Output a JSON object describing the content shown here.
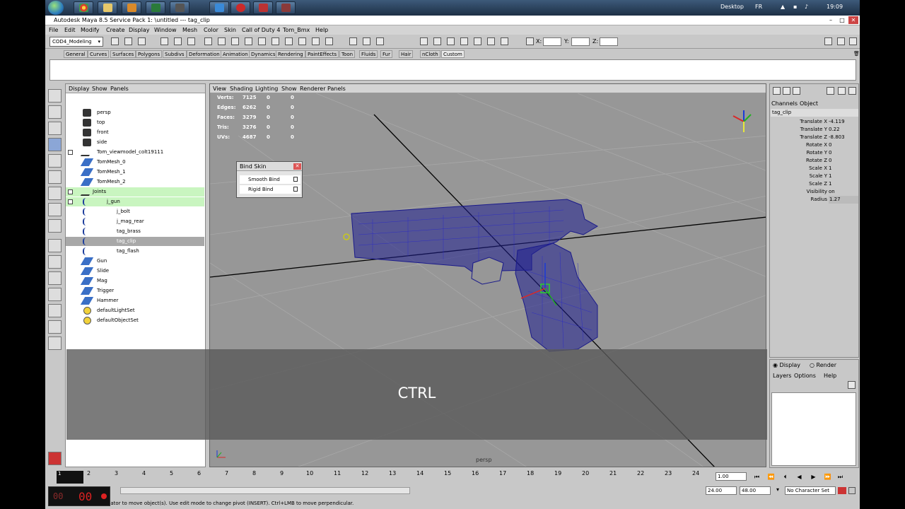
{
  "taskbar": {
    "tray_desktop": "Desktop",
    "tray_lang": "FR",
    "clock": "19:09"
  },
  "window": {
    "title": "Autodesk Maya 8.5 Service Pack 1: \\untitled   ---   tag_clip"
  },
  "menu": [
    "File",
    "Edit",
    "Modify",
    "Create",
    "Display",
    "Window",
    "Mesh",
    "Color",
    "Skin",
    "Call of Duty 4",
    "Tom_Bmx",
    "Help"
  ],
  "status_line": {
    "mode": "COD4_Modeling",
    "x_label": "X:",
    "y_label": "Y:",
    "z_label": "Z:"
  },
  "shelf_tabs": [
    "General",
    "Curves",
    "Surfaces",
    "Polygons",
    "Subdivs",
    "Deformation",
    "Animation",
    "Dynamics",
    "Rendering",
    "PaintEffects",
    "Toon",
    "Fluids",
    "Fur",
    "Hair",
    "nCloth",
    "Custom"
  ],
  "outliner": {
    "menu": [
      "Display",
      "Show",
      "Panels"
    ],
    "rows": [
      {
        "label": "persp"
      },
      {
        "label": "top"
      },
      {
        "label": "front"
      },
      {
        "label": "side"
      },
      {
        "label": "Tom_viewmodel_colt19111"
      },
      {
        "label": "TomMesh_0"
      },
      {
        "label": "TomMesh_1"
      },
      {
        "label": "TomMesh_2"
      },
      {
        "label": "Joints"
      },
      {
        "label": "j_gun"
      },
      {
        "label": "j_bolt"
      },
      {
        "label": "j_mag_rear"
      },
      {
        "label": "tag_brass"
      },
      {
        "label": "tag_clip"
      },
      {
        "label": "tag_flash"
      },
      {
        "label": "Gun"
      },
      {
        "label": "Slide"
      },
      {
        "label": "Mag"
      },
      {
        "label": "Trigger"
      },
      {
        "label": "Hammer"
      },
      {
        "label": "defaultLightSet"
      },
      {
        "label": "defaultObjectSet"
      }
    ]
  },
  "viewport": {
    "menu": [
      "View",
      "Shading",
      "Lighting",
      "Show",
      "Renderer",
      "Panels"
    ],
    "hud": [
      {
        "label": "Verts:",
        "values": [
          "7125",
          "0",
          "0"
        ]
      },
      {
        "label": "Edges:",
        "values": [
          "6262",
          "0",
          "0"
        ]
      },
      {
        "label": "Faces:",
        "values": [
          "3279",
          "0",
          "0"
        ]
      },
      {
        "label": "Tris:",
        "values": [
          "3276",
          "0",
          "0"
        ]
      },
      {
        "label": "UVs:",
        "values": [
          "4687",
          "0",
          "0"
        ]
      }
    ],
    "camera": "persp"
  },
  "bind_skin": {
    "title": "Bind Skin",
    "smooth": "Smooth Bind",
    "rigid": "Rigid Bind"
  },
  "channel_box": {
    "tabs": [
      "Channels",
      "Object"
    ],
    "node": "tag_clip",
    "channels": [
      {
        "name": "Translate X",
        "value": "-4.119"
      },
      {
        "name": "Translate Y",
        "value": "0.22"
      },
      {
        "name": "Translate Z",
        "value": "-8.803"
      },
      {
        "name": "Rotate X",
        "value": "0"
      },
      {
        "name": "Rotate Y",
        "value": "0"
      },
      {
        "name": "Rotate Z",
        "value": "0"
      },
      {
        "name": "Scale X",
        "value": "1"
      },
      {
        "name": "Scale Y",
        "value": "1"
      },
      {
        "name": "Scale Z",
        "value": "1"
      },
      {
        "name": "Visibility",
        "value": "on"
      },
      {
        "name": "Radius",
        "value": "1.27"
      }
    ]
  },
  "layer_editor": {
    "display": "Display",
    "render": "Render",
    "menu": [
      "Layers",
      "Options",
      "Help"
    ]
  },
  "timeline": {
    "ticks": [
      "2",
      "3",
      "4",
      "5",
      "6",
      "7",
      "8",
      "9",
      "10",
      "11",
      "12",
      "13",
      "14",
      "15",
      "16",
      "17",
      "18",
      "19",
      "20",
      "21",
      "22",
      "23",
      "24"
    ],
    "current_frame": "1",
    "current_time": "1.00",
    "range_end": "24.00",
    "anim_end": "48.00",
    "character_set": "No Character Set"
  },
  "help_line": "ulator to move object(s). Use edit mode to change pivot (INSERT). Ctrl+LMB to move perpendicular.",
  "recorder": {
    "hours": "00",
    "minutes": "00"
  },
  "key_overlay": "CTRL"
}
